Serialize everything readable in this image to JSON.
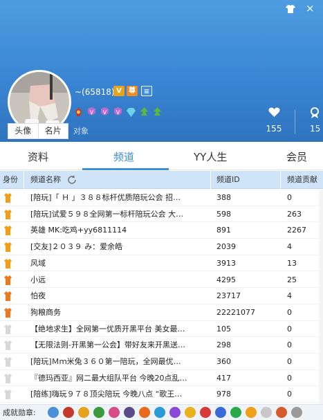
{
  "profile": {
    "nickname": "~(65818)",
    "badges": {
      "v": "V",
      "zun": "尊"
    },
    "avatar_tabs": [
      "头像",
      "名片"
    ],
    "object_label": "对象",
    "likes": "155",
    "second_stat": "15"
  },
  "tabs": [
    "资料",
    "频道",
    "YY人生",
    "会员"
  ],
  "active_tab": "频道",
  "table": {
    "headers": {
      "role": "身份",
      "name": "频道名称",
      "id": "频道ID",
      "contrib": "频道贡献"
    },
    "rows": [
      {
        "name": "[陪玩]「 Ｈ 」３８８标杆优质陪玩公会  招…",
        "id": "388",
        "contrib": "0",
        "role_color": "#f0a018"
      },
      {
        "name": "[陪玩]试爱５９８全网第一标杆陪玩公会  大…",
        "id": "598",
        "contrib": "263",
        "role_color": "#f0a018"
      },
      {
        "name": "英雄 MK:吃鸡+yy6811114",
        "id": "891",
        "contrib": "2267",
        "role_color": "#f0a018"
      },
      {
        "name": "[交友]２０３９  み：爱余皓",
        "id": "2039",
        "contrib": "4",
        "role_color": "#f0a018"
      },
      {
        "name": "风域",
        "id": "3913",
        "contrib": "13",
        "role_color": "#f0a018"
      },
      {
        "name": "小远",
        "id": "4295",
        "contrib": "25",
        "role_color": "#ec7a1c"
      },
      {
        "name": "怕夜",
        "id": "23717",
        "contrib": "4",
        "role_color": "#ec7a1c"
      },
      {
        "name": "狗粮商务",
        "id": "22221077",
        "contrib": "0",
        "role_color": "#ec7a1c"
      },
      {
        "name": "【绝地求生】全网第一优质开黑平台  美女最…",
        "id": "105",
        "contrib": "0",
        "role_color": "#d8d8d8"
      },
      {
        "name": "【无限法则-开黑第一公会】带好友来开黑送…",
        "id": "298",
        "contrib": "0",
        "role_color": "#d8d8d8"
      },
      {
        "name": "[陪玩]Ｍｍ米兔３６０第一陪玩，全网最优…",
        "id": "360",
        "contrib": "0",
        "role_color": "#d8d8d8"
      },
      {
        "name": "『德玛西亚』网二最大组队平台  今晚20点乱…",
        "id": "417",
        "contrib": "0",
        "role_color": "#d8d8d8"
      },
      {
        "name": "[陪练]嗨玩９７８顶尖陪玩 今晚八点 “歌王…",
        "id": "978",
        "contrib": "0",
        "role_color": "#d8d8d8"
      }
    ]
  },
  "medal_bar_label": "成就勋章:",
  "medal_colors": [
    "#4a8fd8",
    "#c43a2a",
    "#e6a21c",
    "#3b9a3b",
    "#d84a8a",
    "#5a4a8a",
    "#e86a1c",
    "#2a9ad8",
    "#8a4ad8",
    "#e8b01c",
    "#d83a3a",
    "#3a6ad8",
    "#2aa84a",
    "#f0a018",
    "#c8c8c8",
    "#d85a2a",
    "#9a9a9a"
  ]
}
